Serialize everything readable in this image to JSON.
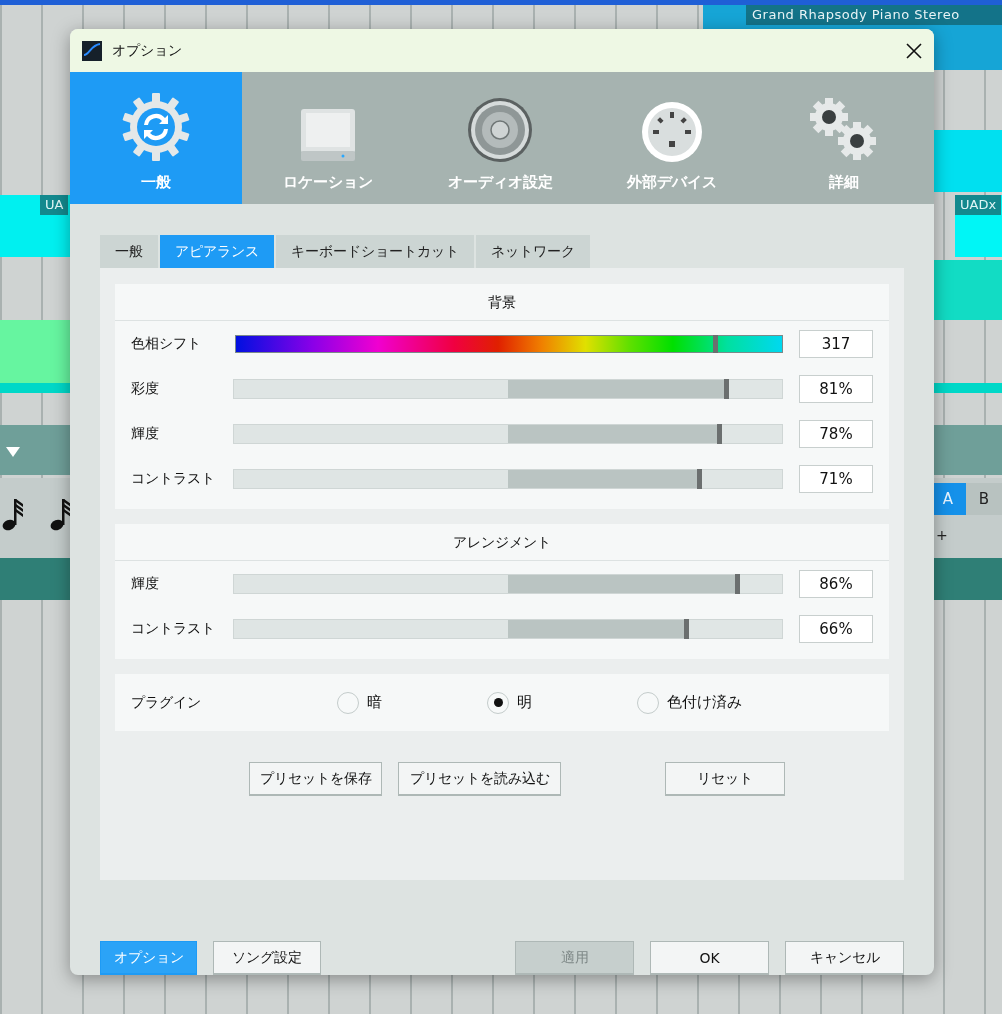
{
  "background": {
    "track_title": "Grand Rhapsody Piano Stereo",
    "clips": [
      "UA",
      "UADx"
    ],
    "pads": [
      {
        "label": "A",
        "selected": true
      },
      {
        "label": "B",
        "selected": false
      }
    ],
    "pad_add": "+"
  },
  "dialog": {
    "title": "オプション",
    "categories": [
      {
        "kind": "general",
        "label": "一般",
        "selected": true
      },
      {
        "kind": "location",
        "label": "ロケーション",
        "selected": false
      },
      {
        "kind": "audio",
        "label": "オーディオ設定",
        "selected": false
      },
      {
        "kind": "devices",
        "label": "外部デバイス",
        "selected": false
      },
      {
        "kind": "advanced",
        "label": "詳細",
        "selected": false
      }
    ],
    "subtabs": [
      {
        "label": "一般",
        "selected": false
      },
      {
        "label": "アピアランス",
        "selected": true
      },
      {
        "label": "キーボードショートカット",
        "selected": false
      },
      {
        "label": "ネットワーク",
        "selected": false
      }
    ],
    "sections": [
      {
        "title": "背景",
        "rows": [
          {
            "kind": "hue",
            "label": "色相シフト",
            "level": 0.88,
            "reading": "317"
          },
          {
            "kind": "slider",
            "label": "彩度",
            "level": 0.9,
            "reading": "81%"
          },
          {
            "kind": "slider",
            "label": "輝度",
            "level": 0.887,
            "reading": "78%"
          },
          {
            "kind": "slider",
            "label": "コントラスト",
            "level": 0.85,
            "reading": "71%"
          }
        ]
      },
      {
        "title": "アレンジメント",
        "rows": [
          {
            "kind": "slider",
            "label": "輝度",
            "level": 0.92,
            "reading": "86%"
          },
          {
            "kind": "slider",
            "label": "コントラスト",
            "level": 0.827,
            "reading": "66%"
          }
        ]
      }
    ],
    "plugin": {
      "label": "プラグイン",
      "options": [
        {
          "label": "暗",
          "selected": false
        },
        {
          "label": "明",
          "selected": true
        },
        {
          "label": "色付け済み",
          "selected": false
        }
      ]
    },
    "preset_buttons": [
      "プリセットを保存",
      "プリセットを読み込む"
    ],
    "reset_button": "リセット",
    "footer_left": [
      {
        "label": "オプション",
        "selected": true
      },
      {
        "label": "ソング設定",
        "selected": false
      }
    ],
    "footer_right": [
      {
        "label": "適用",
        "disabled": true
      },
      {
        "label": "OK",
        "disabled": false
      },
      {
        "label": "キャンセル",
        "disabled": false
      }
    ]
  }
}
